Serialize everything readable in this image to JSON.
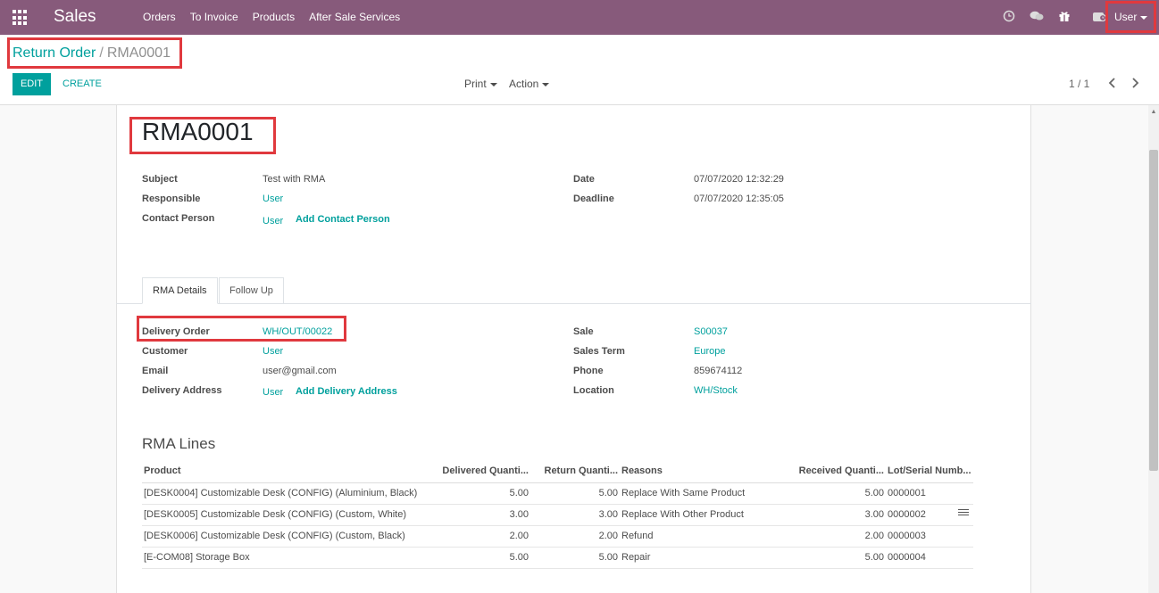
{
  "navbar": {
    "app_name": "Sales",
    "menu": [
      "Orders",
      "To Invoice",
      "Products",
      "After Sale Services"
    ],
    "icons": [
      "clock-icon",
      "chat-icon",
      "gift-icon",
      "activity-icon"
    ],
    "user_label": "User",
    "color": "#875a7b"
  },
  "breadcrumb": {
    "parent": "Return Order",
    "separator": "/",
    "current": "RMA0001"
  },
  "toolbar": {
    "edit_label": "EDIT",
    "create_label": "CREATE",
    "print_label": "Print",
    "action_label": "Action",
    "pager": "1 / 1",
    "accent": "#00a09d"
  },
  "record": {
    "name": "RMA0001",
    "fields_left": [
      {
        "label": "Subject",
        "value": "Test with RMA"
      },
      {
        "label": "Responsible",
        "value": "User"
      },
      {
        "label": "Contact Person",
        "value": "User",
        "action": "Add Contact Person"
      }
    ],
    "fields_right": [
      {
        "label": "Date",
        "value": "07/07/2020 12:32:29"
      },
      {
        "label": "Deadline",
        "value": "07/07/2020 12:35:05"
      }
    ]
  },
  "tabs": [
    {
      "label": "RMA Details",
      "active": true
    },
    {
      "label": "Follow Up",
      "active": false
    }
  ],
  "details": {
    "left": [
      {
        "label": "Delivery Order",
        "value": "WH/OUT/00022"
      },
      {
        "label": "Customer",
        "value": "User"
      },
      {
        "label": "Email",
        "value": "user@gmail.com"
      },
      {
        "label": "Delivery Address",
        "value": "User",
        "action": "Add Delivery Address"
      }
    ],
    "right": [
      {
        "label": "Sale",
        "value": "S00037"
      },
      {
        "label": "Sales Term",
        "value": "Europe"
      },
      {
        "label": "Phone",
        "value": "859674112"
      },
      {
        "label": "Location",
        "value": "WH/Stock"
      }
    ]
  },
  "rma_lines": {
    "title": "RMA Lines",
    "columns": [
      "Product",
      "Delivered Quanti...",
      "Return Quanti...",
      "Reasons",
      "Received Quanti...",
      "Lot/Serial Numb..."
    ],
    "rows": [
      [
        "[DESK0004] Customizable Desk (CONFIG) (Aluminium, Black)",
        "5.00",
        "5.00",
        "Replace With Same Product",
        "5.00",
        "0000001"
      ],
      [
        "[DESK0005] Customizable Desk (CONFIG) (Custom, White)",
        "3.00",
        "3.00",
        "Replace With Other Product",
        "3.00",
        "0000002"
      ],
      [
        "[DESK0006] Customizable Desk (CONFIG) (Custom, Black)",
        "2.00",
        "2.00",
        "Refund",
        "2.00",
        "0000003"
      ],
      [
        "[E-COM08] Storage Box",
        "5.00",
        "5.00",
        "Repair",
        "5.00",
        "0000004"
      ]
    ]
  }
}
